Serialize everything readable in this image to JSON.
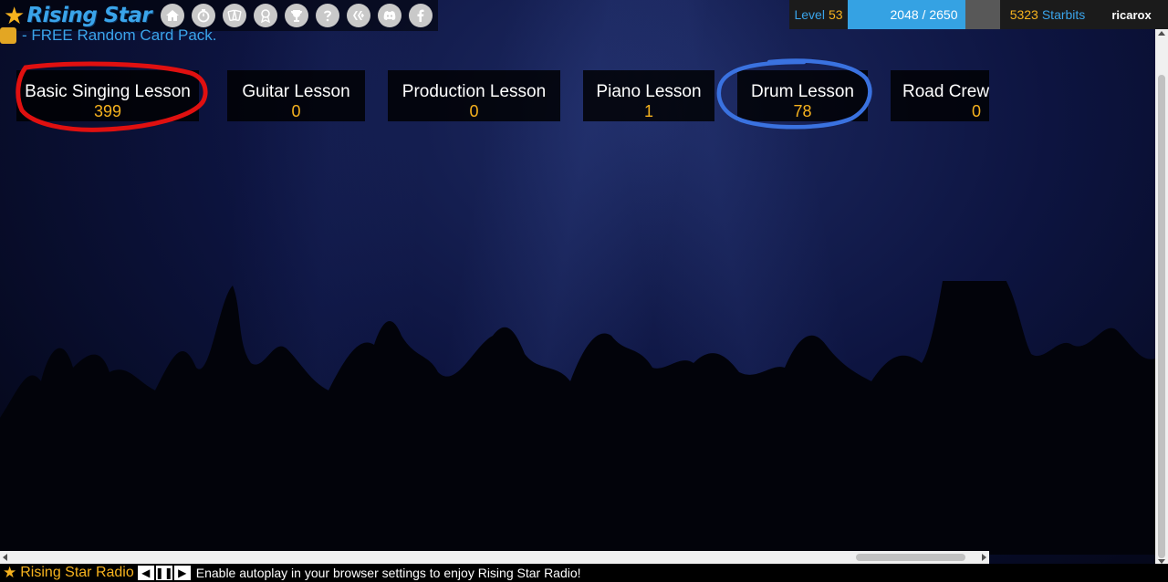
{
  "brand": {
    "name": "Rising Star",
    "accent": "#3aa4ea",
    "gold": "#f6b21e"
  },
  "nav": {
    "icons": [
      "home-icon",
      "gig-icon",
      "cards-icon",
      "award-icon",
      "trophy-icon",
      "help-icon",
      "hive-icon",
      "discord-icon",
      "facebook-icon"
    ]
  },
  "status": {
    "level_label": "Level",
    "level": "53",
    "xp_text": "2048 / 2650",
    "xp_fraction": 0.773,
    "starbits": "5323",
    "starbits_label": "Starbits",
    "username": "ricarox"
  },
  "promo": {
    "text": "- FREE Random Card Pack."
  },
  "lessons": [
    {
      "name": "Basic Singing Lesson",
      "count": "399"
    },
    {
      "name": "Guitar Lesson",
      "count": "0"
    },
    {
      "name": "Production Lesson",
      "count": "0"
    },
    {
      "name": "Piano Lesson",
      "count": "1"
    },
    {
      "name": "Drum Lesson",
      "count": "78"
    },
    {
      "name": "Road Crew",
      "count": "0"
    }
  ],
  "annotations": {
    "red_circle_color": "#e01010",
    "blue_circle_color": "#3a72e0"
  },
  "radio": {
    "title": "Rising Star Radio",
    "message": "Enable autoplay in your browser settings to enjoy Rising Star Radio!"
  }
}
